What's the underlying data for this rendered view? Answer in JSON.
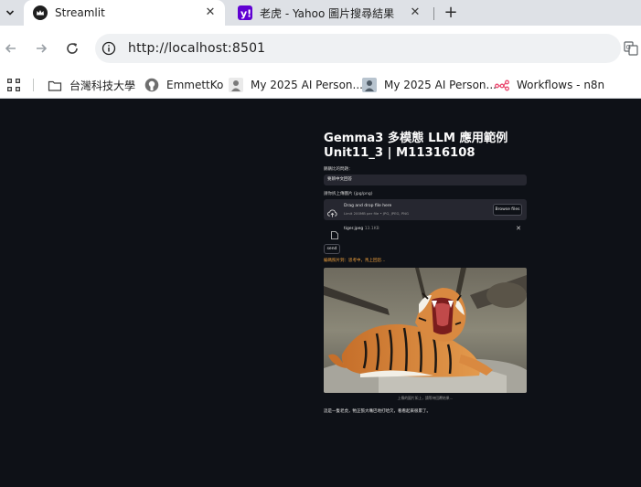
{
  "browser": {
    "tabs": [
      {
        "title": "Streamlit",
        "active": true,
        "icon": "streamlit-crown-icon"
      },
      {
        "title": "老虎 - Yahoo 圖片搜尋結果",
        "active": false,
        "icon": "yahoo-icon"
      }
    ],
    "url": "http://localhost:8501",
    "bookmarks": [
      {
        "label": "台灣科技大學",
        "icon": "folder-icon"
      },
      {
        "label": "EmmettKo",
        "icon": "github-icon"
      },
      {
        "label": "My 2025 AI Person...",
        "icon": "site-avatar-icon"
      },
      {
        "label": "My 2025 AI Person...",
        "icon": "site-avatar-icon"
      },
      {
        "label": "Workflows - n8n",
        "icon": "n8n-icon"
      }
    ],
    "colors": {
      "tabstrip": "#dee1e6",
      "toolbar": "#ffffff",
      "yahoo": "#6001d2",
      "n8n": "#ea4b71"
    }
  },
  "app": {
    "title_line1": "Gemma3 多模態 LLM 應用範例",
    "title_line2": "Unit11_3 | M11316108",
    "select_label": "鵝鵝比的問題：",
    "select_value": "要辨中文回答",
    "upload_label": "請你拆上傳圖片 (jpg/png)",
    "dropzone_title": "Drag and drop file here",
    "dropzone_limit": "Limit 200MB per file • JPG, JPEG, PNG",
    "browse_label": "Browse files",
    "file_name": "tiger.jpeg",
    "file_size": "13.1KB",
    "send_label": "send",
    "status_text": "編碼照片到：思考中，馬上回您…",
    "image_caption": "上傳的圖片如上，請等待回覆結果…",
    "answer": "這是一隻老虎，牠正張大嘴巴地打哈欠，看看起來很累了。",
    "colors": {
      "background": "#0e1117",
      "widget": "#262730",
      "status": "#f0a13c",
      "text": "#fafafa"
    }
  }
}
